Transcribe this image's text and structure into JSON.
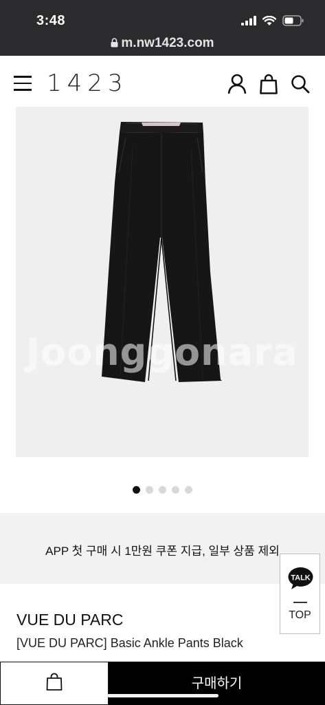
{
  "status_bar": {
    "time": "3:48"
  },
  "browser": {
    "url": "m.nw1423.com"
  },
  "header": {
    "logo": "1423",
    "icons": [
      "menu-icon",
      "user-icon",
      "shopping-bag-icon",
      "search-icon"
    ]
  },
  "product_image": {
    "watermark": "Joonggonara"
  },
  "carousel": {
    "total": 5,
    "active_index": 0
  },
  "promo": {
    "text": "APP 첫 구매 시 1만원 쿠폰 지급, 일부 상품 제외"
  },
  "floating": {
    "talk_label": "TALK",
    "top_label": "TOP"
  },
  "product": {
    "brand": "VUE DU PARC",
    "name": "[VUE DU PARC] Basic Ankle Pants Black"
  },
  "bottom_bar": {
    "buy_label": "구매하기"
  },
  "colors": {
    "browser_bar": "#2b2b2d",
    "image_bg": "#efefef",
    "promo_bg": "#f2f2f2",
    "buy_button_bg": "#000000"
  }
}
